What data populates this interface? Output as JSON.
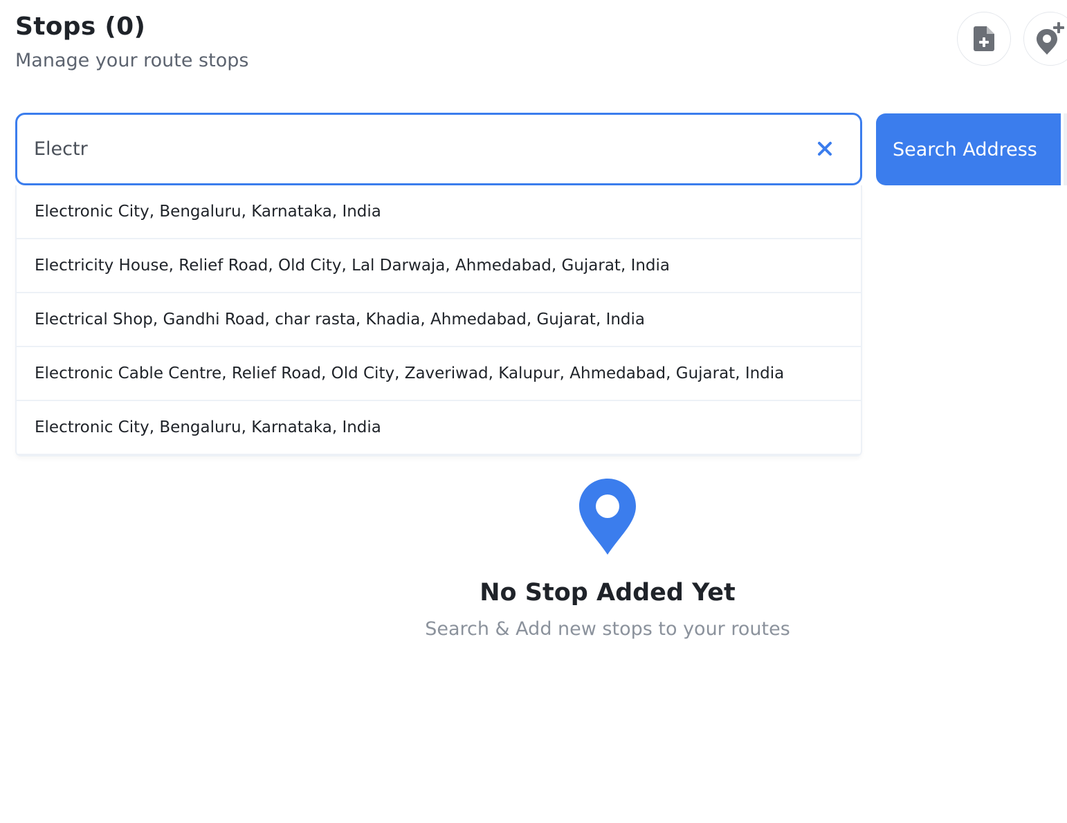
{
  "header": {
    "title": "Stops (0)",
    "subtitle": "Manage your route stops",
    "actions": [
      {
        "icon": "file-plus-icon"
      },
      {
        "icon": "pin-plus-icon"
      }
    ]
  },
  "search": {
    "value": "Electr",
    "placeholder": "",
    "button_label": "Search Address",
    "suggestions": [
      "Electronic City, Bengaluru, Karnataka, India",
      "Electricity House, Relief Road, Old City, Lal Darwaja, Ahmedabad, Gujarat, India",
      "Electrical Shop, Gandhi Road, char rasta, Khadia, Ahmedabad, Gujarat, India",
      "Electronic Cable Centre, Relief Road, Old City, Zaveriwad, Kalupur, Ahmedabad, Gujarat, India",
      "Electronic City, Bengaluru, Karnataka, India"
    ]
  },
  "empty_state": {
    "icon": "map-pin-icon",
    "title": "No Stop Added Yet",
    "subtitle": "Search & Add new stops to your routes"
  },
  "colors": {
    "accent": "#3b7ded",
    "text": "#1f2329",
    "muted": "#8b929c",
    "icon_gray": "#6b6f76"
  }
}
